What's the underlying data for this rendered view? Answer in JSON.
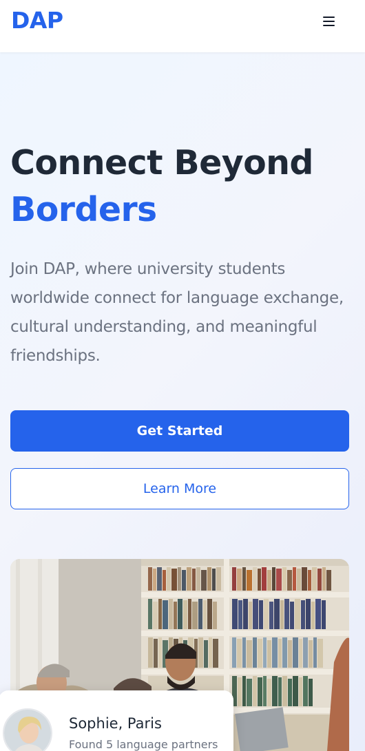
{
  "header": {
    "logo": "DAP",
    "menu_icon": "hamburger-menu-icon"
  },
  "hero": {
    "title_line1": "Connect Beyond",
    "title_line2": "Borders",
    "subtitle": "Join DAP, where university students worldwide connect for language exchange, cultural understanding, and meaningful friendships.",
    "primary_button": "Get Started",
    "secondary_button": "Learn More"
  },
  "testimonial": {
    "name": "Sophie, Paris",
    "text": "Found 5 language partners"
  },
  "colors": {
    "accent": "#2563eb",
    "heading": "#1f2937",
    "body_text": "#6b7280",
    "background": "#eff6ff"
  }
}
